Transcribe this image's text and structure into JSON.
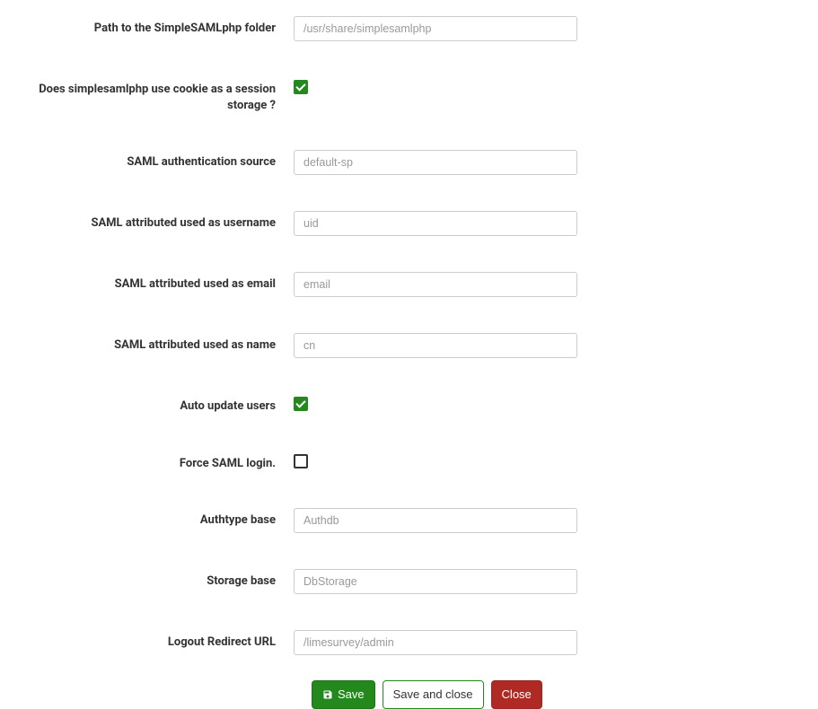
{
  "fields": {
    "simplesamlphp_path": {
      "label": "Path to the SimpleSAMLphp folder",
      "value": "/usr/share/simplesamlphp"
    },
    "use_cookie_session": {
      "label": "Does simplesamlphp use cookie as a session storage ?",
      "checked": true
    },
    "auth_source": {
      "label": "SAML authentication source",
      "value": "default-sp"
    },
    "attr_username": {
      "label": "SAML attributed used as username",
      "value": "uid"
    },
    "attr_email": {
      "label": "SAML attributed used as email",
      "value": "email"
    },
    "attr_name": {
      "label": "SAML attributed used as name",
      "value": "cn"
    },
    "auto_update_users": {
      "label": "Auto update users",
      "checked": true
    },
    "force_saml_login": {
      "label": "Force SAML login.",
      "checked": false
    },
    "authtype_base": {
      "label": "Authtype base",
      "value": "Authdb"
    },
    "storage_base": {
      "label": "Storage base",
      "value": "DbStorage"
    },
    "logout_redirect": {
      "label": "Logout Redirect URL",
      "value": "/limesurvey/admin"
    }
  },
  "buttons": {
    "save": "Save",
    "save_and_close": "Save and close",
    "close": "Close"
  }
}
